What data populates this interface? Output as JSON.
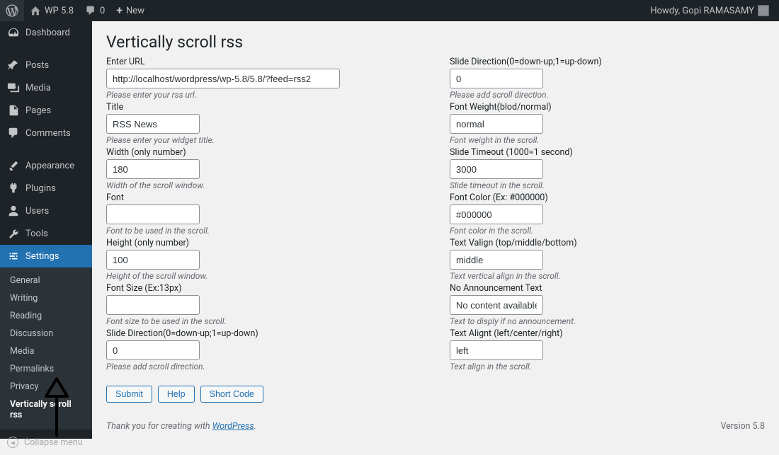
{
  "adminbar": {
    "site_name": "WP 5.8",
    "comment_count": "0",
    "new_label": "New",
    "howdy_prefix": "Howdy,",
    "user_display": "Gopi RAMASAMY"
  },
  "sidebar": {
    "dashboard": "Dashboard",
    "posts": "Posts",
    "media": "Media",
    "pages": "Pages",
    "comments": "Comments",
    "appearance": "Appearance",
    "plugins": "Plugins",
    "users": "Users",
    "tools": "Tools",
    "settings": "Settings",
    "collapse": "Collapse menu",
    "settings_sub": {
      "general": "General",
      "writing": "Writing",
      "reading": "Reading",
      "discussion": "Discussion",
      "media": "Media",
      "permalinks": "Permalinks",
      "privacy": "Privacy",
      "vsr": "Vertically scroll rss"
    }
  },
  "page": {
    "title": "Vertically scroll rss",
    "thank_prefix": "Thank you for creating with ",
    "thank_link": "WordPress",
    "thank_suffix": ".",
    "version": "Version 5.8",
    "buttons": {
      "submit": "Submit",
      "help": "Help",
      "shortcode": "Short Code"
    }
  },
  "left_fields": {
    "url": {
      "label": "Enter URL",
      "value": "http://localhost/wordpress/wp-5.8/5.8/?feed=rss2",
      "hint": "Please enter your rss url."
    },
    "titlef": {
      "label": "Title",
      "value": "RSS News",
      "hint": "Please enter your widget title."
    },
    "width": {
      "label": "Width (only number)",
      "value": "180",
      "hint": "Width of the scroll window."
    },
    "font": {
      "label": "Font",
      "value": "",
      "hint": "Font to be used in the scroll."
    },
    "height": {
      "label": "Height (only number)",
      "value": "100",
      "hint": "Height of the scroll window."
    },
    "fontsize": {
      "label": "Font Size (Ex:13px)",
      "value": "",
      "hint": "Font size to be used in the scroll."
    },
    "slidedir": {
      "label": "Slide Direction(0=down-up;1=up-down)",
      "value": "0",
      "hint": "Please add scroll direction."
    }
  },
  "right_fields": {
    "slidedir2": {
      "label": "Slide Direction(0=down-up;1=up-down)",
      "value": "0",
      "hint": "Please add scroll direction."
    },
    "fweight": {
      "label": "Font Weight(blod/normal)",
      "value": "normal",
      "hint": "Font weight in the scroll."
    },
    "timeout": {
      "label": "Slide Timeout (1000=1 second)",
      "value": "3000",
      "hint": "Slide timeout in the scroll."
    },
    "fcolor": {
      "label": "Font Color (Ex: #000000)",
      "value": "#000000",
      "hint": "Font color in the scroll."
    },
    "valign": {
      "label": "Text Valign (top/middle/bottom)",
      "value": "middle",
      "hint": "Text vertical align in the scroll."
    },
    "noann": {
      "label": "No Announcement Text",
      "value": "No content available",
      "hint": "Text to disply if no announcement."
    },
    "talign": {
      "label": "Text Alignt (left/center/right)",
      "value": "left",
      "hint": "Text align in the scroll."
    }
  }
}
